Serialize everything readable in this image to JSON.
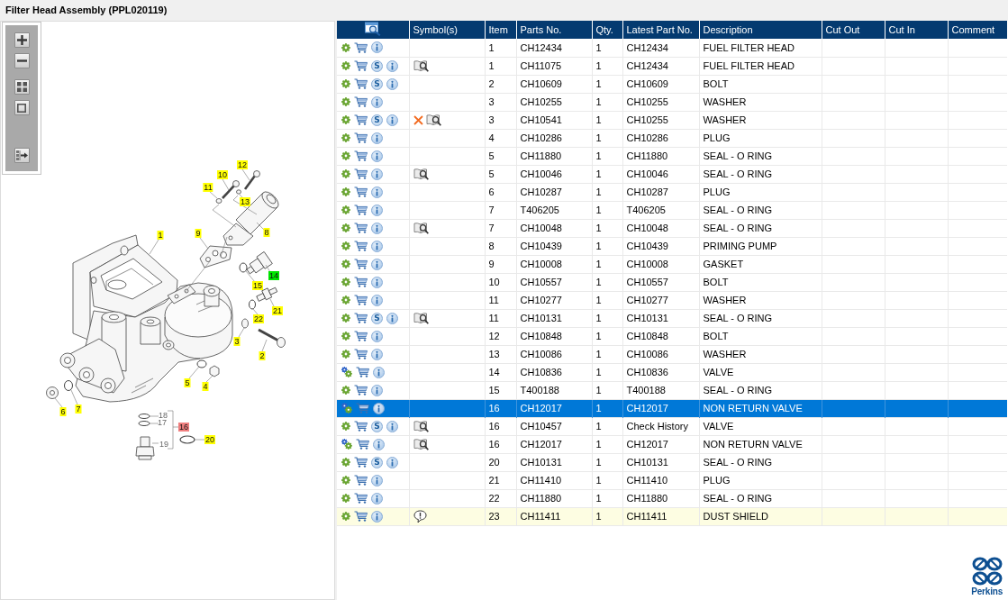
{
  "window": {
    "title": "Filter Head Assembly (PPL020119)"
  },
  "diagram": {
    "callouts": [
      {
        "label": "12",
        "kind": "tag",
        "color": "#ffff00"
      },
      {
        "label": "10",
        "kind": "tag",
        "color": "#ffff00"
      },
      {
        "label": "11",
        "kind": "tag",
        "color": "#ffff00"
      },
      {
        "label": "13",
        "kind": "tag",
        "color": "#ffff00"
      },
      {
        "label": "1",
        "kind": "tag",
        "color": "#ffff00"
      },
      {
        "label": "9",
        "kind": "tag",
        "color": "#ffff00"
      },
      {
        "label": "8",
        "kind": "tag",
        "color": "#ffff00"
      },
      {
        "label": "14",
        "kind": "tag",
        "color": "#00e600"
      },
      {
        "label": "15",
        "kind": "tag",
        "color": "#ffff00"
      },
      {
        "label": "21",
        "kind": "tag",
        "color": "#ffff00"
      },
      {
        "label": "22",
        "kind": "tag",
        "color": "#ffff00"
      },
      {
        "label": "3",
        "kind": "tag",
        "color": "#ffff00"
      },
      {
        "label": "2",
        "kind": "tag",
        "color": "#ffff00"
      },
      {
        "label": "5",
        "kind": "tag",
        "color": "#ffff00"
      },
      {
        "label": "4",
        "kind": "tag",
        "color": "#ffff00"
      },
      {
        "label": "6",
        "kind": "tag",
        "color": "#ffff00"
      },
      {
        "label": "7",
        "kind": "tag",
        "color": "#ffff00"
      },
      {
        "label": "18",
        "kind": "plain"
      },
      {
        "label": "17",
        "kind": "plain"
      },
      {
        "label": "16",
        "kind": "tag",
        "color": "#f08080"
      },
      {
        "label": "20",
        "kind": "tag",
        "color": "#ffff00"
      },
      {
        "label": "19",
        "kind": "plain"
      }
    ]
  },
  "parts_table": {
    "columns": [
      "Symbol(s)",
      "Item",
      "Parts No.",
      "Qty.",
      "Latest Part No.",
      "Description",
      "Cut Out",
      "Cut In",
      "Comment"
    ],
    "rows": [
      {
        "kind": "single",
        "item": "1",
        "parts_no": "CH12434",
        "qty": "1",
        "latest_part_no": "CH12434",
        "description": "FUEL FILTER HEAD",
        "selected": false,
        "highlighted": false
      },
      {
        "kind": "single",
        "s_badge": "S",
        "symbols": [
          {
            "kind": "book"
          }
        ],
        "item": "1",
        "parts_no": "CH11075",
        "qty": "1",
        "latest_part_no": "CH12434",
        "description": "FUEL FILTER HEAD",
        "selected": false,
        "highlighted": false
      },
      {
        "kind": "single",
        "s_badge": "S",
        "item": "2",
        "parts_no": "CH10609",
        "qty": "1",
        "latest_part_no": "CH10609",
        "description": "BOLT",
        "selected": false,
        "highlighted": false
      },
      {
        "kind": "single",
        "item": "3",
        "parts_no": "CH10255",
        "qty": "1",
        "latest_part_no": "CH10255",
        "description": "WASHER",
        "selected": false,
        "highlighted": false
      },
      {
        "kind": "single",
        "s_badge": "S",
        "symbols": [
          {
            "kind": "cross"
          },
          {
            "kind": "book"
          }
        ],
        "item": "3",
        "parts_no": "CH10541",
        "qty": "1",
        "latest_part_no": "CH10255",
        "description": "WASHER",
        "selected": false,
        "highlighted": false
      },
      {
        "kind": "single",
        "item": "4",
        "parts_no": "CH10286",
        "qty": "1",
        "latest_part_no": "CH10286",
        "description": "PLUG",
        "selected": false,
        "highlighted": false
      },
      {
        "kind": "single",
        "item": "5",
        "parts_no": "CH11880",
        "qty": "1",
        "latest_part_no": "CH11880",
        "description": "SEAL - O RING",
        "selected": false,
        "highlighted": false
      },
      {
        "kind": "single",
        "symbols": [
          {
            "kind": "book"
          }
        ],
        "item": "5",
        "parts_no": "CH10046",
        "qty": "1",
        "latest_part_no": "CH10046",
        "description": "SEAL - O RING",
        "selected": false,
        "highlighted": false
      },
      {
        "kind": "single",
        "item": "6",
        "parts_no": "CH10287",
        "qty": "1",
        "latest_part_no": "CH10287",
        "description": "PLUG",
        "selected": false,
        "highlighted": false
      },
      {
        "kind": "single",
        "item": "7",
        "parts_no": "T406205",
        "qty": "1",
        "latest_part_no": "T406205",
        "description": "SEAL - O RING",
        "selected": false,
        "highlighted": false
      },
      {
        "kind": "single",
        "symbols": [
          {
            "kind": "book"
          }
        ],
        "item": "7",
        "parts_no": "CH10048",
        "qty": "1",
        "latest_part_no": "CH10048",
        "description": "SEAL - O RING",
        "selected": false,
        "highlighted": false
      },
      {
        "kind": "single",
        "item": "8",
        "parts_no": "CH10439",
        "qty": "1",
        "latest_part_no": "CH10439",
        "description": "PRIMING PUMP",
        "selected": false,
        "highlighted": false
      },
      {
        "kind": "single",
        "item": "9",
        "parts_no": "CH10008",
        "qty": "1",
        "latest_part_no": "CH10008",
        "description": "GASKET",
        "selected": false,
        "highlighted": false
      },
      {
        "kind": "single",
        "item": "10",
        "parts_no": "CH10557",
        "qty": "1",
        "latest_part_no": "CH10557",
        "description": "BOLT",
        "selected": false,
        "highlighted": false
      },
      {
        "kind": "single",
        "item": "11",
        "parts_no": "CH10277",
        "qty": "1",
        "latest_part_no": "CH10277",
        "description": "WASHER",
        "selected": false,
        "highlighted": false
      },
      {
        "kind": "single",
        "s_badge": "S",
        "symbols": [
          {
            "kind": "book"
          }
        ],
        "item": "11",
        "parts_no": "CH10131",
        "qty": "1",
        "latest_part_no": "CH10131",
        "description": "SEAL - O RING",
        "selected": false,
        "highlighted": false
      },
      {
        "kind": "single",
        "item": "12",
        "parts_no": "CH10848",
        "qty": "1",
        "latest_part_no": "CH10848",
        "description": "BOLT",
        "selected": false,
        "highlighted": false
      },
      {
        "kind": "single",
        "item": "13",
        "parts_no": "CH10086",
        "qty": "1",
        "latest_part_no": "CH10086",
        "description": "WASHER",
        "selected": false,
        "highlighted": false
      },
      {
        "kind": "double",
        "item": "14",
        "parts_no": "CH10836",
        "qty": "1",
        "latest_part_no": "CH10836",
        "description": "VALVE",
        "selected": false,
        "highlighted": false
      },
      {
        "kind": "single",
        "item": "15",
        "parts_no": "T400188",
        "qty": "1",
        "latest_part_no": "T400188",
        "description": "SEAL - O RING",
        "selected": false,
        "highlighted": false
      },
      {
        "kind": "double",
        "item": "16",
        "parts_no": "CH12017",
        "qty": "1",
        "latest_part_no": "CH12017",
        "description": "NON RETURN VALVE",
        "selected": true,
        "highlighted": false
      },
      {
        "kind": "single",
        "s_badge": "S",
        "symbols": [
          {
            "kind": "book"
          }
        ],
        "item": "16",
        "parts_no": "CH10457",
        "qty": "1",
        "latest_part_no": "Check History",
        "description": "VALVE",
        "selected": false,
        "highlighted": false
      },
      {
        "kind": "double",
        "symbols": [
          {
            "kind": "book"
          }
        ],
        "item": "16",
        "parts_no": "CH12017",
        "qty": "1",
        "latest_part_no": "CH12017",
        "description": "NON RETURN VALVE",
        "selected": false,
        "highlighted": false
      },
      {
        "kind": "single",
        "s_badge": "S",
        "item": "20",
        "parts_no": "CH10131",
        "qty": "1",
        "latest_part_no": "CH10131",
        "description": "SEAL - O RING",
        "selected": false,
        "highlighted": false
      },
      {
        "kind": "single",
        "item": "21",
        "parts_no": "CH11410",
        "qty": "1",
        "latest_part_no": "CH11410",
        "description": "PLUG",
        "selected": false,
        "highlighted": false
      },
      {
        "kind": "single",
        "item": "22",
        "parts_no": "CH11880",
        "qty": "1",
        "latest_part_no": "CH11880",
        "description": "SEAL - O RING",
        "selected": false,
        "highlighted": false
      },
      {
        "kind": "single",
        "symbols": [
          {
            "kind": "alert"
          }
        ],
        "item": "23",
        "parts_no": "CH11411",
        "qty": "1",
        "latest_part_no": "CH11411",
        "description": "DUST SHIELD",
        "selected": false,
        "highlighted": true
      }
    ]
  },
  "logo": {
    "text": "Perkins"
  }
}
